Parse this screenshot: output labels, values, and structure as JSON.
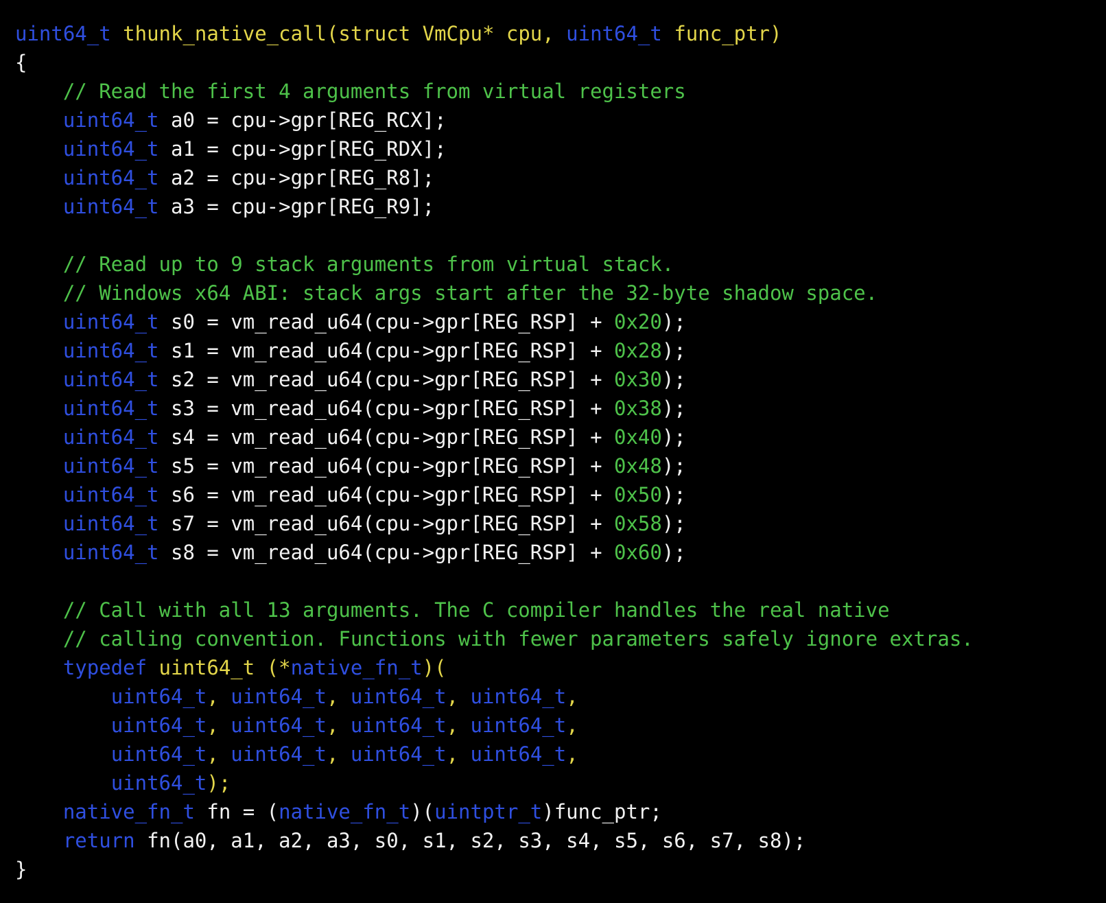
{
  "colors": {
    "background": "#000000",
    "type": "#2f4fe0",
    "keyword": "#2f4fe0",
    "function": "#e3d64a",
    "comment": "#4ec24a",
    "number": "#4ec24a",
    "plain": "#f2f2f2"
  },
  "code": {
    "lines": [
      [
        {
          "t": "uint64_t",
          "k": "type"
        },
        {
          "t": " ",
          "k": "plain"
        },
        {
          "t": "thunk_native_call(struct VmCpu* cpu, ",
          "k": "func"
        },
        {
          "t": "uint64_t",
          "k": "type"
        },
        {
          "t": " func_ptr)",
          "k": "func"
        }
      ],
      [
        {
          "t": "{",
          "k": "plain"
        }
      ],
      [
        {
          "t": "    // Read the first 4 arguments from virtual registers",
          "k": "comment"
        }
      ],
      [
        {
          "t": "    ",
          "k": "plain"
        },
        {
          "t": "uint64_t",
          "k": "type"
        },
        {
          "t": " a0 = cpu->gpr[REG_RCX];",
          "k": "plain"
        }
      ],
      [
        {
          "t": "    ",
          "k": "plain"
        },
        {
          "t": "uint64_t",
          "k": "type"
        },
        {
          "t": " a1 = cpu->gpr[REG_RDX];",
          "k": "plain"
        }
      ],
      [
        {
          "t": "    ",
          "k": "plain"
        },
        {
          "t": "uint64_t",
          "k": "type"
        },
        {
          "t": " a2 = cpu->gpr[REG_R8];",
          "k": "plain"
        }
      ],
      [
        {
          "t": "    ",
          "k": "plain"
        },
        {
          "t": "uint64_t",
          "k": "type"
        },
        {
          "t": " a3 = cpu->gpr[REG_R9];",
          "k": "plain"
        }
      ],
      [],
      [
        {
          "t": "    // Read up to 9 stack arguments from virtual stack.",
          "k": "comment"
        }
      ],
      [
        {
          "t": "    // Windows x64 ABI: stack args start after the 32-byte shadow space.",
          "k": "comment"
        }
      ],
      [
        {
          "t": "    ",
          "k": "plain"
        },
        {
          "t": "uint64_t",
          "k": "type"
        },
        {
          "t": " s0 = vm_read_u64(cpu->gpr[REG_RSP] + ",
          "k": "plain"
        },
        {
          "t": "0x20",
          "k": "number"
        },
        {
          "t": ");",
          "k": "plain"
        }
      ],
      [
        {
          "t": "    ",
          "k": "plain"
        },
        {
          "t": "uint64_t",
          "k": "type"
        },
        {
          "t": " s1 = vm_read_u64(cpu->gpr[REG_RSP] + ",
          "k": "plain"
        },
        {
          "t": "0x28",
          "k": "number"
        },
        {
          "t": ");",
          "k": "plain"
        }
      ],
      [
        {
          "t": "    ",
          "k": "plain"
        },
        {
          "t": "uint64_t",
          "k": "type"
        },
        {
          "t": " s2 = vm_read_u64(cpu->gpr[REG_RSP] + ",
          "k": "plain"
        },
        {
          "t": "0x30",
          "k": "number"
        },
        {
          "t": ");",
          "k": "plain"
        }
      ],
      [
        {
          "t": "    ",
          "k": "plain"
        },
        {
          "t": "uint64_t",
          "k": "type"
        },
        {
          "t": " s3 = vm_read_u64(cpu->gpr[REG_RSP] + ",
          "k": "plain"
        },
        {
          "t": "0x38",
          "k": "number"
        },
        {
          "t": ");",
          "k": "plain"
        }
      ],
      [
        {
          "t": "    ",
          "k": "plain"
        },
        {
          "t": "uint64_t",
          "k": "type"
        },
        {
          "t": " s4 = vm_read_u64(cpu->gpr[REG_RSP] + ",
          "k": "plain"
        },
        {
          "t": "0x40",
          "k": "number"
        },
        {
          "t": ");",
          "k": "plain"
        }
      ],
      [
        {
          "t": "    ",
          "k": "plain"
        },
        {
          "t": "uint64_t",
          "k": "type"
        },
        {
          "t": " s5 = vm_read_u64(cpu->gpr[REG_RSP] + ",
          "k": "plain"
        },
        {
          "t": "0x48",
          "k": "number"
        },
        {
          "t": ");",
          "k": "plain"
        }
      ],
      [
        {
          "t": "    ",
          "k": "plain"
        },
        {
          "t": "uint64_t",
          "k": "type"
        },
        {
          "t": " s6 = vm_read_u64(cpu->gpr[REG_RSP] + ",
          "k": "plain"
        },
        {
          "t": "0x50",
          "k": "number"
        },
        {
          "t": ");",
          "k": "plain"
        }
      ],
      [
        {
          "t": "    ",
          "k": "plain"
        },
        {
          "t": "uint64_t",
          "k": "type"
        },
        {
          "t": " s7 = vm_read_u64(cpu->gpr[REG_RSP] + ",
          "k": "plain"
        },
        {
          "t": "0x58",
          "k": "number"
        },
        {
          "t": ");",
          "k": "plain"
        }
      ],
      [
        {
          "t": "    ",
          "k": "plain"
        },
        {
          "t": "uint64_t",
          "k": "type"
        },
        {
          "t": " s8 = vm_read_u64(cpu->gpr[REG_RSP] + ",
          "k": "plain"
        },
        {
          "t": "0x60",
          "k": "number"
        },
        {
          "t": ");",
          "k": "plain"
        }
      ],
      [],
      [
        {
          "t": "    // Call with all 13 arguments. The C compiler handles the real native",
          "k": "comment"
        }
      ],
      [
        {
          "t": "    // calling convention. Functions with fewer parameters safely ignore extras.",
          "k": "comment"
        }
      ],
      [
        {
          "t": "    ",
          "k": "plain"
        },
        {
          "t": "typedef",
          "k": "keyword"
        },
        {
          "t": " uint64_t (*",
          "k": "func"
        },
        {
          "t": "native_fn_t",
          "k": "type"
        },
        {
          "t": ")(",
          "k": "func"
        }
      ],
      [
        {
          "t": "        ",
          "k": "plain"
        },
        {
          "t": "uint64_t",
          "k": "type"
        },
        {
          "t": ", ",
          "k": "func"
        },
        {
          "t": "uint64_t",
          "k": "type"
        },
        {
          "t": ", ",
          "k": "func"
        },
        {
          "t": "uint64_t",
          "k": "type"
        },
        {
          "t": ", ",
          "k": "func"
        },
        {
          "t": "uint64_t",
          "k": "type"
        },
        {
          "t": ",",
          "k": "func"
        }
      ],
      [
        {
          "t": "        ",
          "k": "plain"
        },
        {
          "t": "uint64_t",
          "k": "type"
        },
        {
          "t": ", ",
          "k": "func"
        },
        {
          "t": "uint64_t",
          "k": "type"
        },
        {
          "t": ", ",
          "k": "func"
        },
        {
          "t": "uint64_t",
          "k": "type"
        },
        {
          "t": ", ",
          "k": "func"
        },
        {
          "t": "uint64_t",
          "k": "type"
        },
        {
          "t": ",",
          "k": "func"
        }
      ],
      [
        {
          "t": "        ",
          "k": "plain"
        },
        {
          "t": "uint64_t",
          "k": "type"
        },
        {
          "t": ", ",
          "k": "func"
        },
        {
          "t": "uint64_t",
          "k": "type"
        },
        {
          "t": ", ",
          "k": "func"
        },
        {
          "t": "uint64_t",
          "k": "type"
        },
        {
          "t": ", ",
          "k": "func"
        },
        {
          "t": "uint64_t",
          "k": "type"
        },
        {
          "t": ",",
          "k": "func"
        }
      ],
      [
        {
          "t": "        ",
          "k": "plain"
        },
        {
          "t": "uint64_t",
          "k": "type"
        },
        {
          "t": ");",
          "k": "func"
        }
      ],
      [
        {
          "t": "    ",
          "k": "plain"
        },
        {
          "t": "native_fn_t",
          "k": "type"
        },
        {
          "t": " fn = (",
          "k": "plain"
        },
        {
          "t": "native_fn_t",
          "k": "type"
        },
        {
          "t": ")(",
          "k": "plain"
        },
        {
          "t": "uintptr_t",
          "k": "type"
        },
        {
          "t": ")func_ptr;",
          "k": "plain"
        }
      ],
      [
        {
          "t": "    ",
          "k": "plain"
        },
        {
          "t": "return",
          "k": "keyword"
        },
        {
          "t": " fn(a0, a1, a2, a3, s0, s1, s2, s3, s4, s5, s6, s7, s8);",
          "k": "plain"
        }
      ],
      [
        {
          "t": "}",
          "k": "plain"
        }
      ]
    ]
  }
}
